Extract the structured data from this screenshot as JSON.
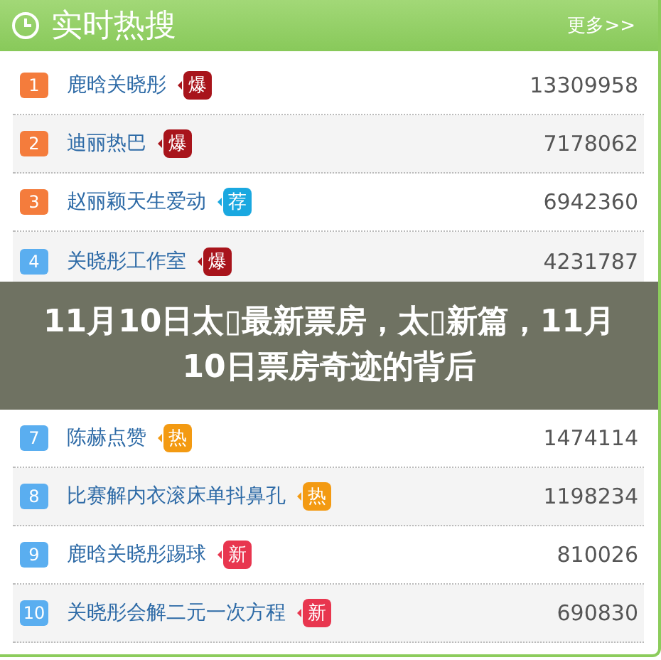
{
  "header": {
    "title": "实时热搜",
    "more_link": "更多>>"
  },
  "rows_above": [
    {
      "rank": "1",
      "color": "#f47c3c",
      "topic": "鹿晗关晓彤",
      "tag": {
        "text": "爆",
        "color": "#a8141b"
      },
      "count": "13309958"
    },
    {
      "rank": "2",
      "color": "#f47c3c",
      "topic": "迪丽热巴",
      "tag": {
        "text": "爆",
        "color": "#a8141b"
      },
      "count": "7178062"
    },
    {
      "rank": "3",
      "color": "#f47c3c",
      "topic": "赵丽颖天生爱动",
      "tag": {
        "text": "荐",
        "color": "#1aa8e0"
      },
      "count": "6942360"
    },
    {
      "rank": "4",
      "color": "#5aaef0",
      "topic": "关晓彤工作室",
      "tag": {
        "text": "爆",
        "color": "#a8141b"
      },
      "count": "4231787"
    }
  ],
  "banner": {
    "title": "11月10日太▯最新票房，太▯新篇，11月10日票房奇迹的背后"
  },
  "rows_below": [
    {
      "rank": "7",
      "color": "#5aaef0",
      "topic": "陈赫点赞",
      "tag": {
        "text": "热",
        "color": "#f39a12"
      },
      "count": "1474114"
    },
    {
      "rank": "8",
      "color": "#5aaef0",
      "topic": "比赛解内衣滚床单抖鼻孔",
      "tag": {
        "text": "热",
        "color": "#f39a12"
      },
      "count": "1198234"
    },
    {
      "rank": "9",
      "color": "#5aaef0",
      "topic": "鹿晗关晓彤踢球",
      "tag": {
        "text": "新",
        "color": "#e8364f"
      },
      "count": "810026"
    },
    {
      "rank": "10",
      "color": "#5aaef0",
      "topic": "关晓彤会解二元一次方程",
      "tag": {
        "text": "新",
        "color": "#e8364f"
      },
      "count": "690830"
    }
  ]
}
